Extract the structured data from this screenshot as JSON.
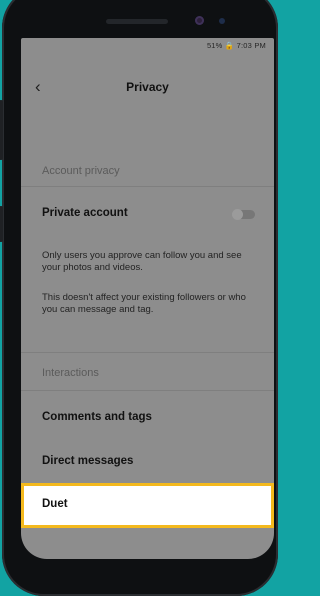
{
  "status": {
    "text": "51% 🔒 7:03 PM"
  },
  "nav": {
    "back_icon": "chevron-left-icon",
    "title": "Privacy"
  },
  "sections": {
    "account_privacy": "Account privacy",
    "interactions": "Interactions"
  },
  "private_account": {
    "label": "Private account",
    "toggle_on": false,
    "desc1": "Only users you approve can follow you and see your photos and videos.",
    "desc2": "This doesn't affect your existing followers or who you can message and tag."
  },
  "items": {
    "comments_and_tags": "Comments and tags",
    "direct_messages": "Direct messages",
    "duet": "Duet"
  },
  "colors": {
    "accent": "#f4b91d",
    "overlay": "#8d8d8d",
    "background": "#12a3a3"
  }
}
